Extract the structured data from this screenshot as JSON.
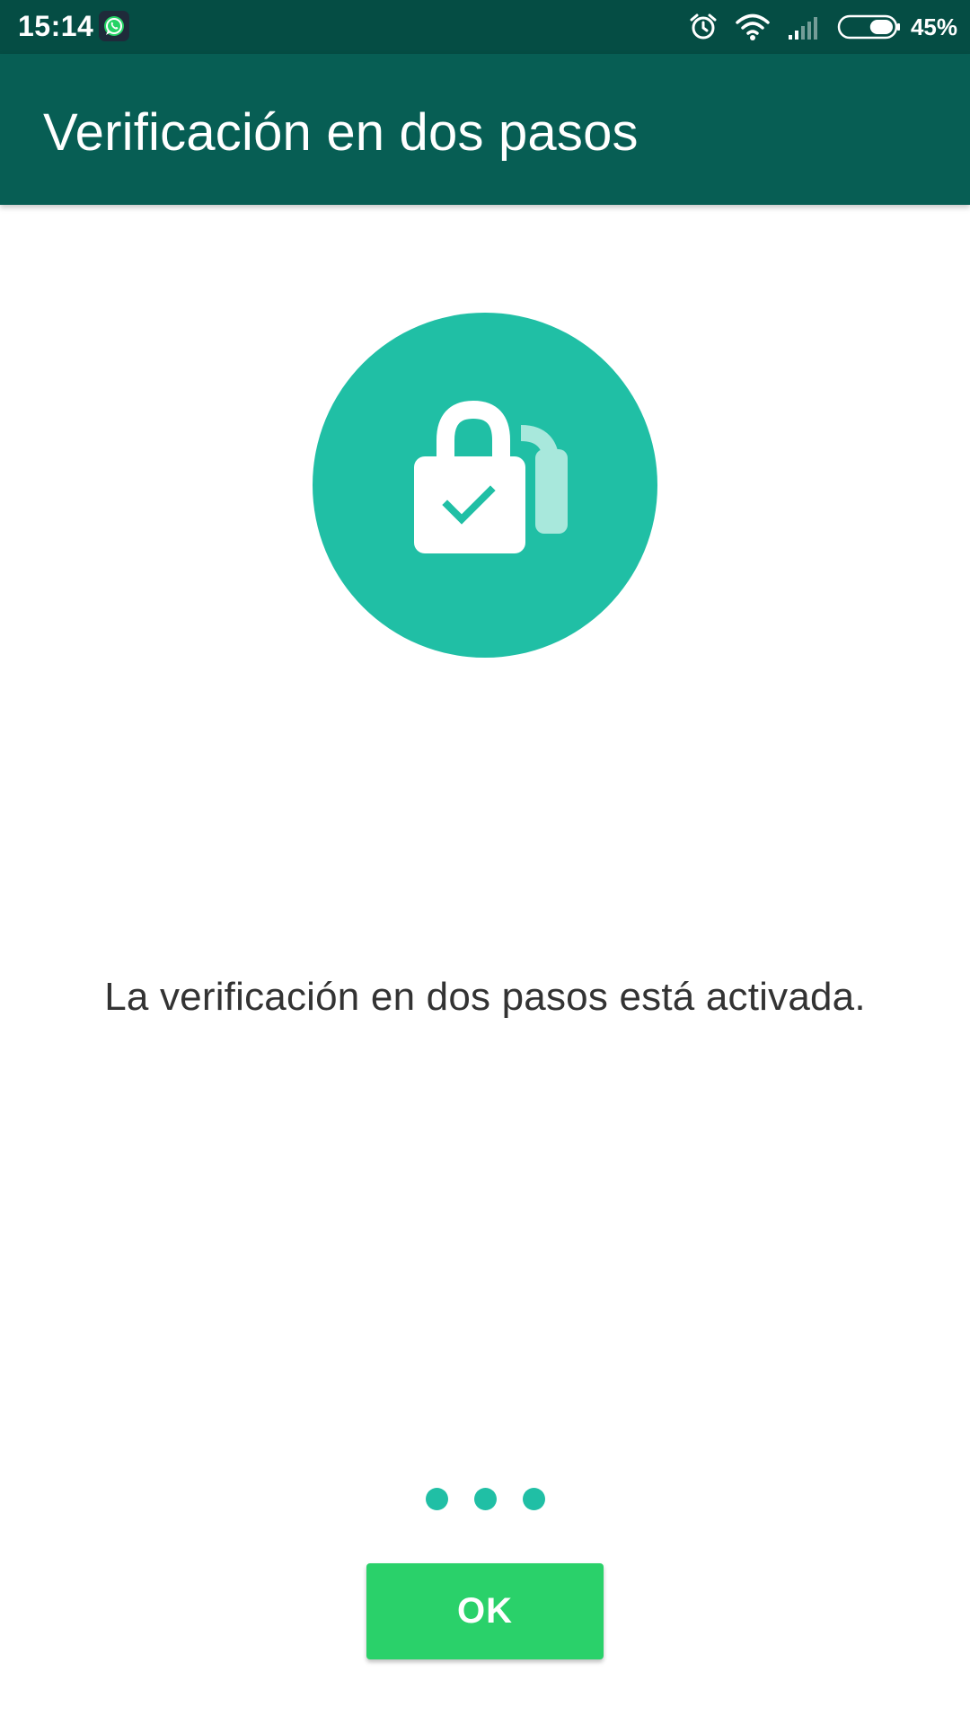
{
  "status_bar": {
    "time": "15:14",
    "app_icon": "whatsapp-icon",
    "icons": [
      "alarm-icon",
      "wifi-icon",
      "signal-icon",
      "battery-icon"
    ],
    "battery_level": 0.45,
    "battery_text": "45%"
  },
  "app_bar": {
    "title": "Verificación en dos pasos"
  },
  "hero": {
    "icon": "lock-check-icon"
  },
  "message": "La verificación en dos pasos está activada.",
  "pager": {
    "dots": 3
  },
  "ok_button": {
    "label": "OK"
  },
  "colors": {
    "status_bar": "#054d44",
    "app_bar": "#075e54",
    "accent_teal": "#20bfa5",
    "button_green": "#2ad16a",
    "text_dark": "#333333"
  }
}
